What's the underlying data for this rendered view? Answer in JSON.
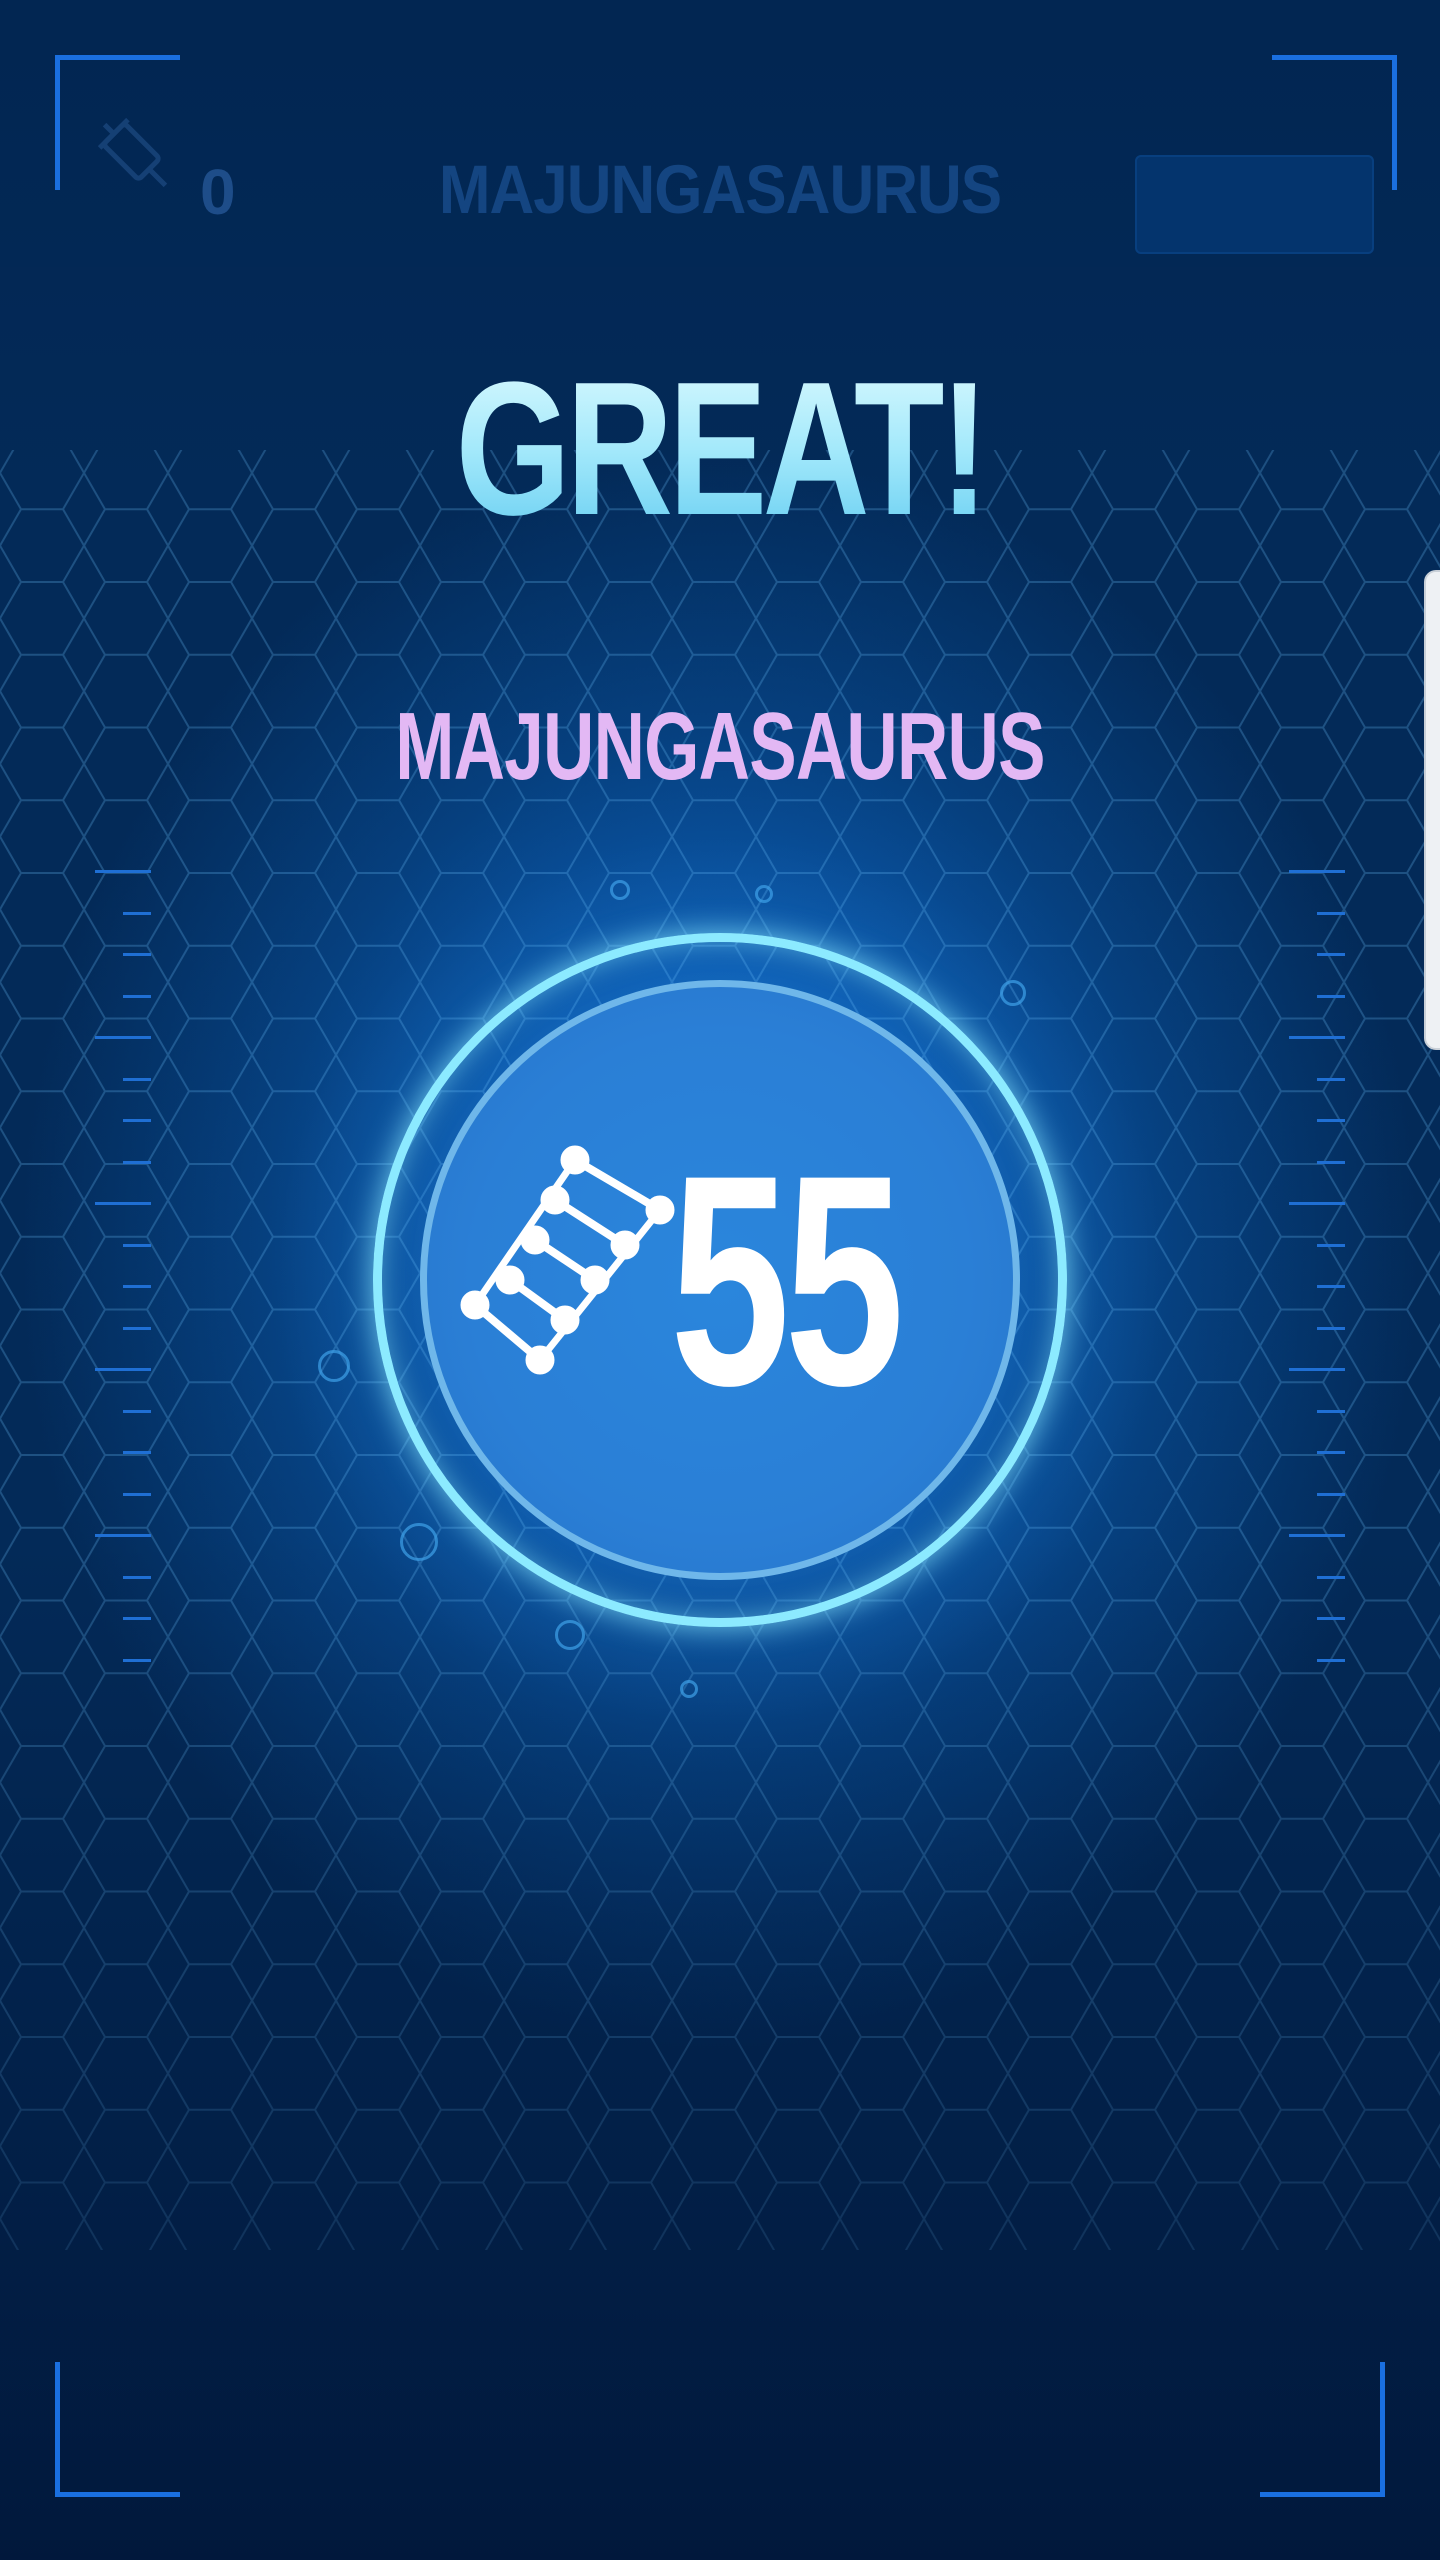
{
  "top_bar": {
    "syringe_icon": "syringe-icon",
    "count": "0",
    "title": "MAJUNGASAURUS"
  },
  "result": {
    "headline": "GREAT!",
    "dinosaur_name": "MAJUNGASAURUS",
    "dna_icon": "dna-icon",
    "dna_amount": "55"
  },
  "colors": {
    "headline": "#a4e9fb",
    "dinosaur_name": "#e3b8f4",
    "ring": "#8ceaff",
    "accent": "#1a6fe0"
  }
}
